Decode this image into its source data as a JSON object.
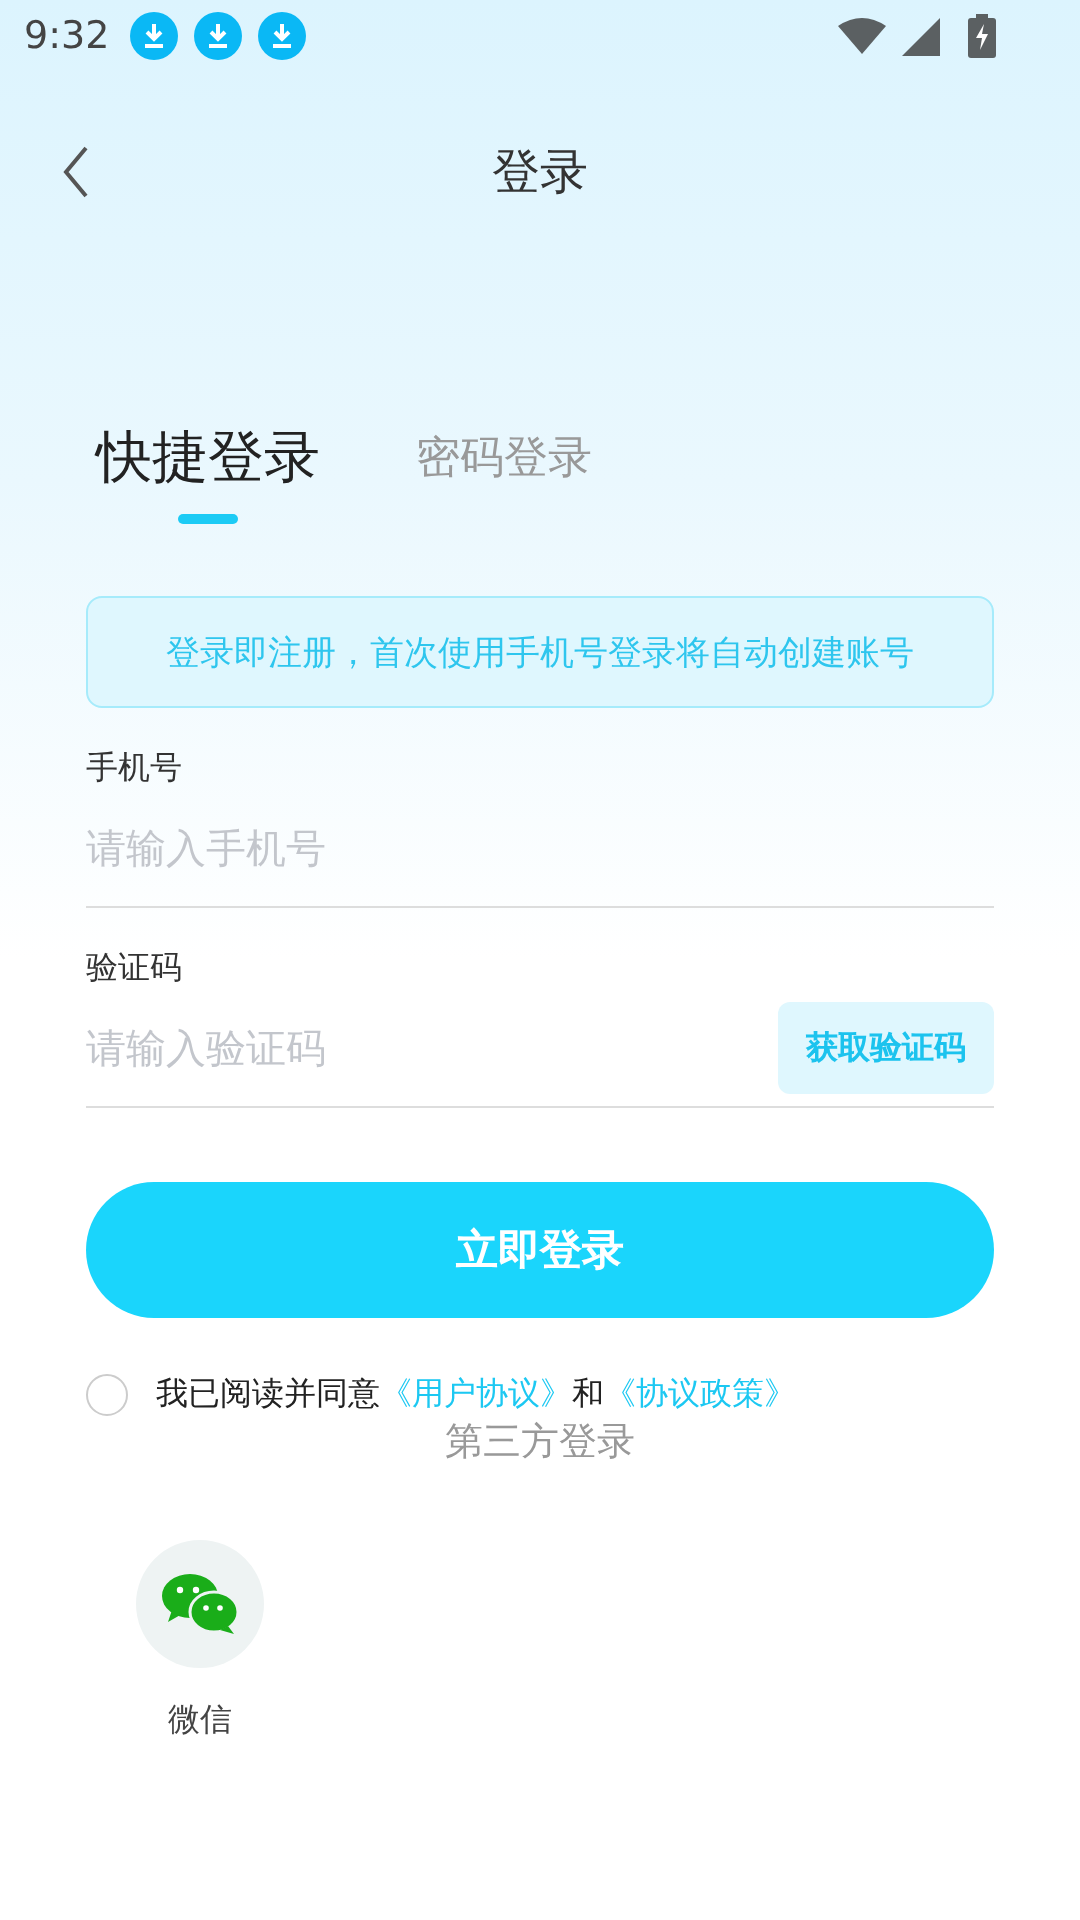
{
  "status_bar": {
    "time": "9:32",
    "notifications": [
      {
        "kind": "download"
      },
      {
        "kind": "download"
      },
      {
        "kind": "download"
      }
    ]
  },
  "header": {
    "title": "登录"
  },
  "tabs": [
    {
      "label": "快捷登录",
      "selected": true
    },
    {
      "label": "密码登录",
      "selected": false
    }
  ],
  "notice": "登录即注册，首次使用手机号登录将自动创建账号",
  "fields": [
    {
      "label": "手机号",
      "placeholder": "请输入手机号"
    },
    {
      "label": "验证码",
      "placeholder": "请输入验证码",
      "action": "获取验证码"
    }
  ],
  "login_button": "立即登录",
  "agreement": {
    "checked": false,
    "parts": [
      {
        "kind": "text",
        "text": "我已阅读并同意"
      },
      {
        "kind": "link",
        "text": "《用户协议》"
      },
      {
        "kind": "text",
        "text": "和"
      },
      {
        "kind": "link",
        "text": "《协议政策》"
      }
    ]
  },
  "third_party": {
    "title": "第三方登录",
    "options": [
      {
        "label": "微信"
      }
    ]
  }
}
